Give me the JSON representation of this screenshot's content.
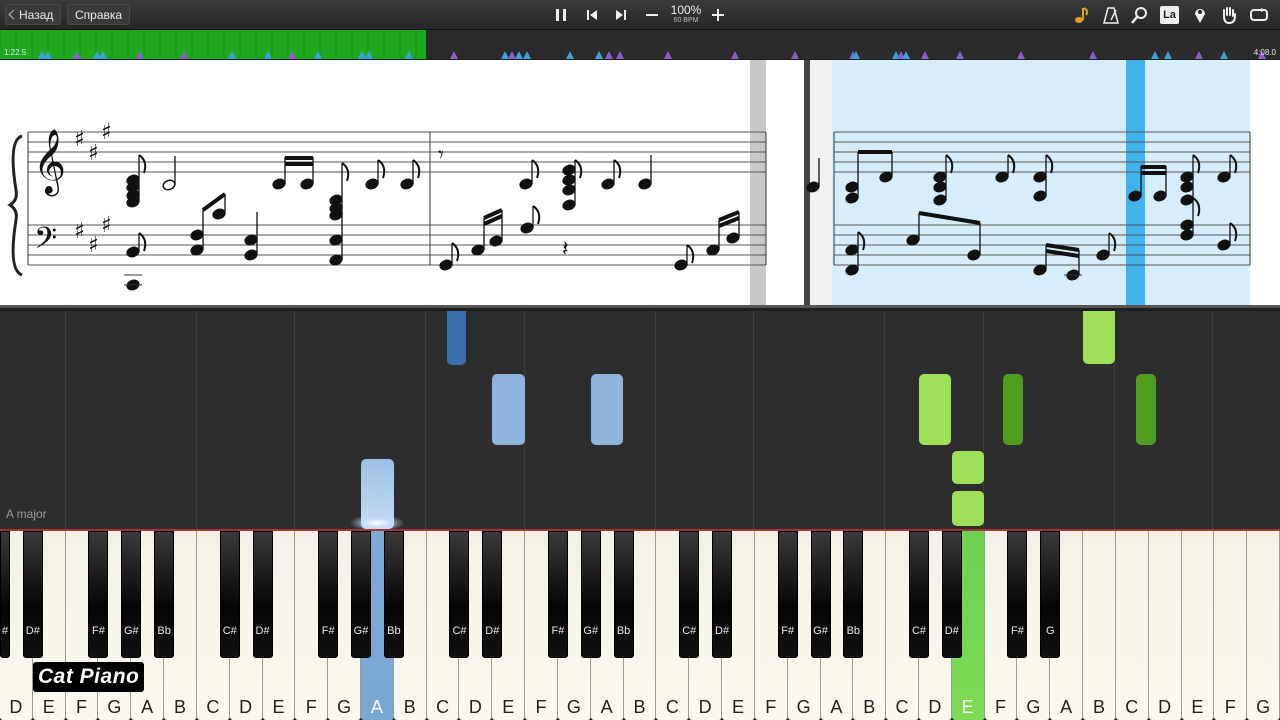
{
  "toolbar": {
    "back_label": "Назад",
    "help_label": "Справка",
    "zoom": "100%",
    "bpm": "60 BPM",
    "icons": [
      "pause-icon",
      "previous-icon",
      "next-icon",
      "minus-icon",
      "plus-icon",
      "note-icon",
      "metronome-icon",
      "search-icon",
      "label-icon",
      "marker-icon",
      "hand-icon",
      "loop-icon"
    ],
    "la_label": "La"
  },
  "timeline": {
    "elapsed": "1:22.5",
    "total": "4:08.0",
    "progress_fraction": 0.333
  },
  "falling": {
    "key_signature": "A major"
  },
  "keyboard": {
    "white_keys": [
      "D",
      "E",
      "F",
      "G",
      "A",
      "B",
      "C",
      "D",
      "E",
      "F",
      "G",
      "A",
      "B",
      "C",
      "D",
      "E",
      "F",
      "G",
      "A",
      "B",
      "C",
      "D",
      "E",
      "F",
      "G",
      "A",
      "B",
      "C",
      "D",
      "E",
      "F",
      "G",
      "A",
      "B",
      "C",
      "D",
      "E",
      "F",
      "G"
    ],
    "black_keys": [
      "#",
      "D#",
      "F#",
      "G#",
      "Bb",
      "C#",
      "D#",
      "F#",
      "G#",
      "Bb",
      "C#",
      "D#",
      "F#",
      "G#",
      "Bb",
      "C#",
      "D#",
      "F#",
      "G#",
      "Bb",
      "C#",
      "D#",
      "F#",
      "G"
    ],
    "pressed": [
      {
        "key": "A",
        "color": "blue"
      },
      {
        "key": "E",
        "color": "green"
      }
    ]
  },
  "watermark": "Cat Piano",
  "colors": {
    "progress": "#1ea81e",
    "right_hand": "#8eb4dc",
    "right_hand_dark": "#3d6eb0",
    "left_hand": "#9ee05a",
    "left_hand_dark": "#4f9c1f",
    "highlight": "#d6eefb",
    "cursor": "#3fb3ec"
  }
}
